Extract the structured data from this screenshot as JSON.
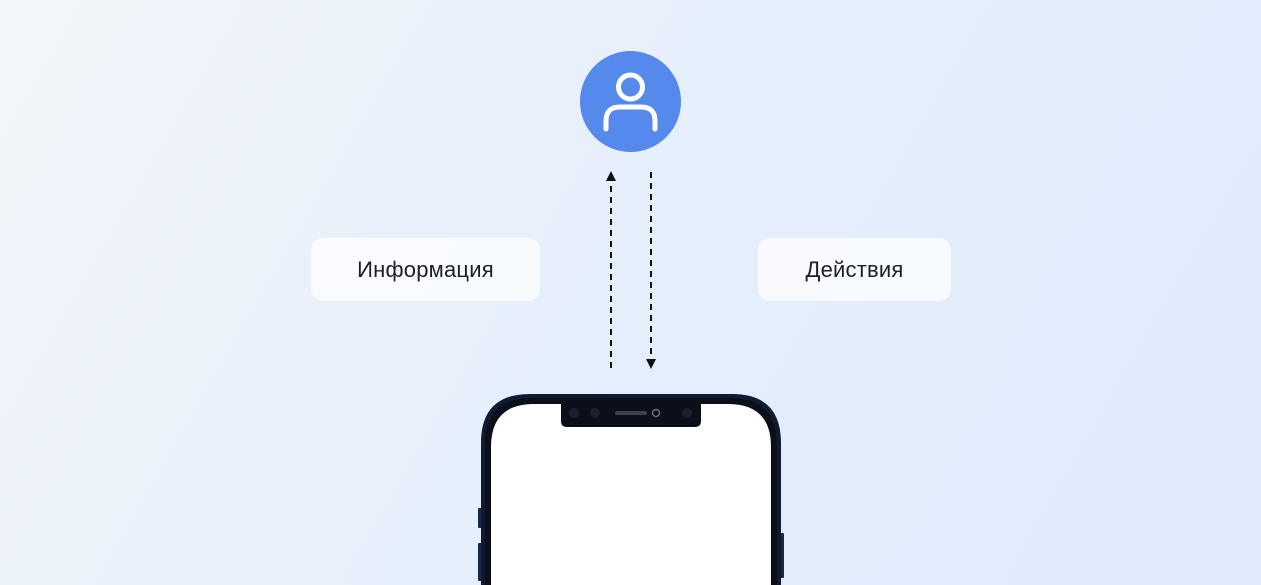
{
  "diagram": {
    "user_node": {
      "icon": "user-icon",
      "color": "#5689ec"
    },
    "labels": {
      "upward": "Информация",
      "downward": "Действия"
    },
    "device": {
      "icon": "smartphone-icon",
      "frame_color": "#101a33",
      "screen_color": "#ffffff"
    }
  }
}
